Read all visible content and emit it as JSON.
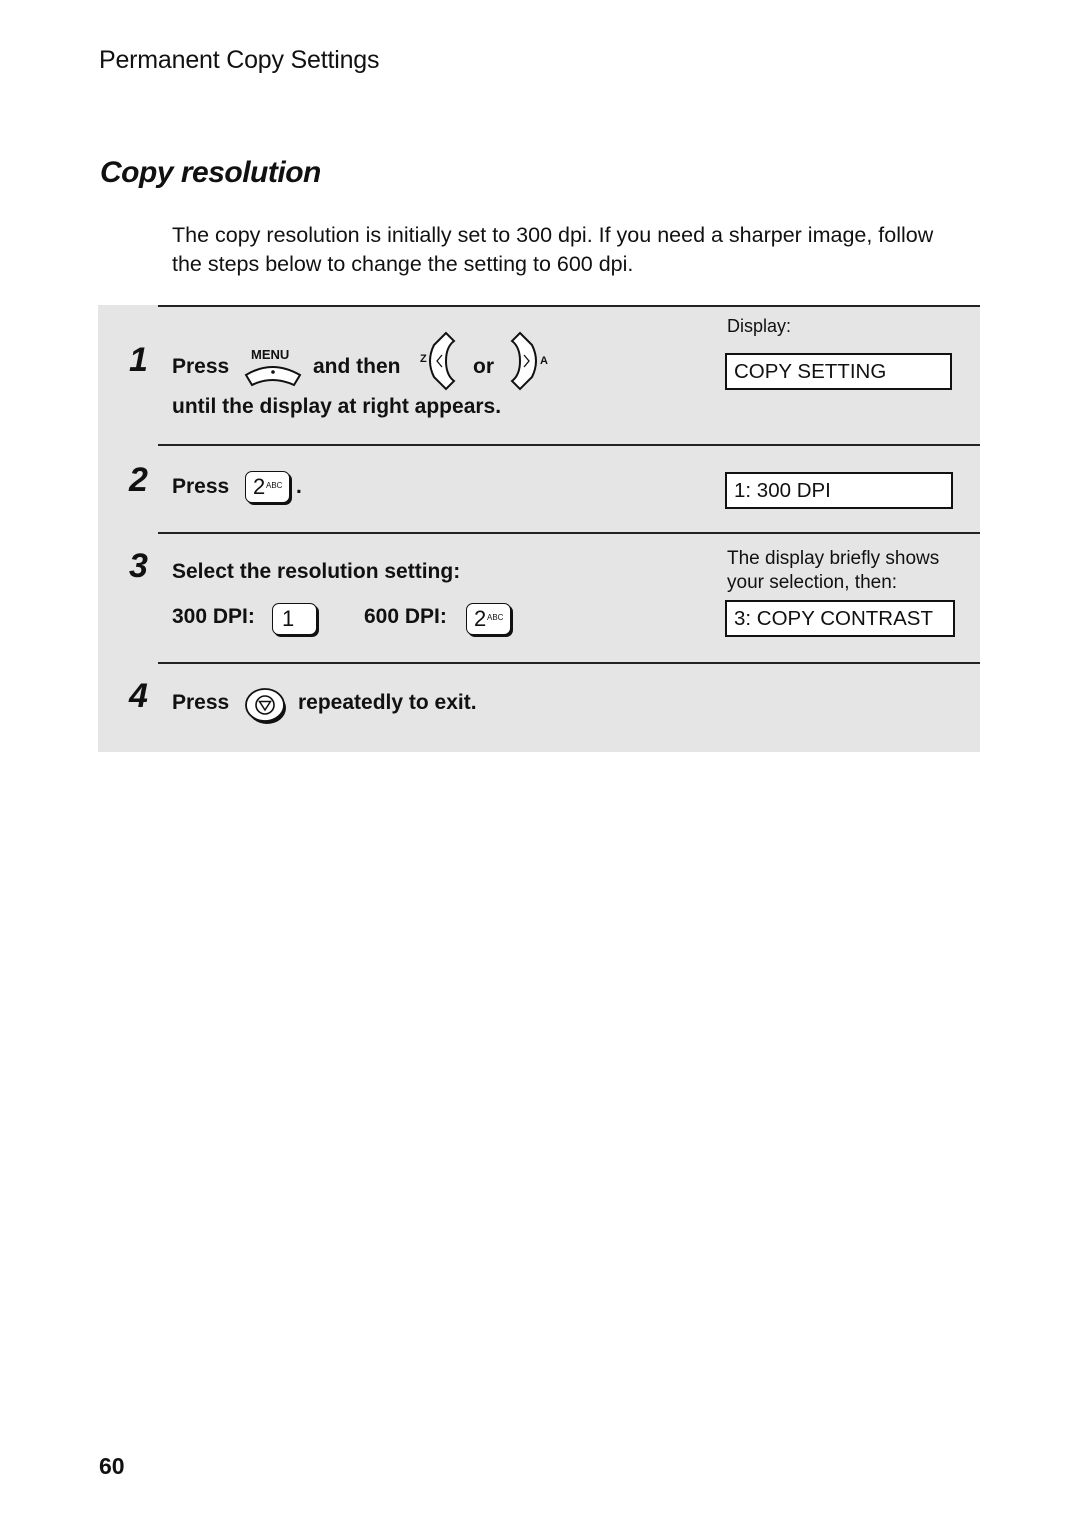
{
  "running_head": "Permanent Copy Settings",
  "section_title": "Copy resolution",
  "intro": "The copy resolution is initially set to 300 dpi. If you need a sharper image, follow the steps below to change the setting to 600 dpi.",
  "display_label": "Display:",
  "steps": [
    {
      "number": "1",
      "press": "Press",
      "menu_key_label": "MENU",
      "and_then": "and then",
      "left_key_label": "Z",
      "or": "or",
      "right_key_label": "A",
      "line2": "until the display at right appears.",
      "display": "COPY SETTING"
    },
    {
      "number": "2",
      "press": "Press",
      "key_digit": "2",
      "key_letters": "ABC",
      "period": ".",
      "display": "1: 300 DPI"
    },
    {
      "number": "3",
      "text": "Select the resolution setting:",
      "option_300_label": "300 DPI:",
      "option_300_key": "1",
      "option_600_label": "600 DPI:",
      "option_600_key_digit": "2",
      "option_600_key_letters": "ABC",
      "note": "The display briefly shows your selection, then:",
      "display": "3: COPY CONTRAST"
    },
    {
      "number": "4",
      "press": "Press",
      "after": "repeatedly to exit."
    }
  ],
  "page_number": "60"
}
